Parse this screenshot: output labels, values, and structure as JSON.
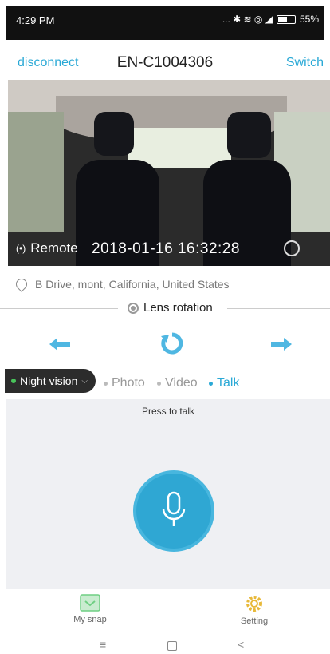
{
  "status_bar": {
    "time": "4:29 PM",
    "indicators": "... ✱ ≋ ◎ ◢",
    "battery": "55%"
  },
  "header": {
    "disconnect_label": "disconnect",
    "title": "EN-C1004306",
    "switch_label": "Switch"
  },
  "camera": {
    "remote_label": "Remote",
    "timestamp": "2018-01-16  16:32:28"
  },
  "location": {
    "text": "B     Drive,      mont, California, United States"
  },
  "lens": {
    "label": "Lens rotation"
  },
  "modes": {
    "night_vision_label": "Night vision",
    "photo_label": "Photo",
    "video_label": "Video",
    "talk_label": "Talk",
    "active": "Talk"
  },
  "talk": {
    "press_label": "Press to talk"
  },
  "tabs": {
    "snap_label": "My snap",
    "setting_label": "Setting"
  },
  "nav": {
    "menu": "≡",
    "back": "<"
  },
  "colors": {
    "accent": "#2aa9d6",
    "mic": "#2fa7d3",
    "night_dot": "#48c35a",
    "talk_bg": "#eff0f3"
  },
  "icons": [
    "signal-icon",
    "location-pin-icon",
    "lens-icon",
    "arrow-left-icon",
    "rotate-icon",
    "arrow-right-icon",
    "chevron-down-icon",
    "microphone-icon",
    "snap-icon",
    "gear-icon"
  ]
}
